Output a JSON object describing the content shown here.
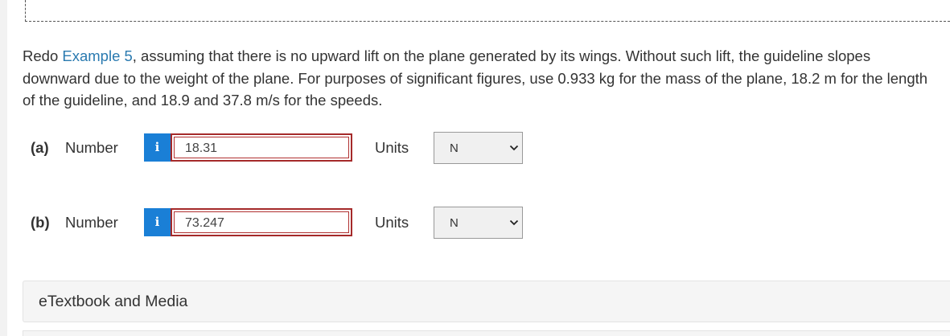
{
  "question": {
    "prefix": "Redo ",
    "link_text": "Example 5",
    "suffix": ", assuming that there is no upward lift on the plane generated by its wings. Without such lift, the guideline slopes downward due to the weight of the plane. For purposes of significant figures, use 0.933 kg for the mass of the plane, 18.2 m for the length of the guideline, and 18.9 and 37.8 m/s for the speeds."
  },
  "parts": [
    {
      "label": "(a)",
      "number_label": "Number",
      "info_icon": "i",
      "answer_value": "18.31",
      "units_label": "Units",
      "units_value": "N"
    },
    {
      "label": "(b)",
      "number_label": "Number",
      "info_icon": "i",
      "answer_value": "73.247",
      "units_label": "Units",
      "units_value": "N"
    }
  ],
  "etextbook": {
    "label": "eTextbook and Media"
  },
  "colors": {
    "link": "#2a7ab0",
    "info_button": "#1a7fd6",
    "answer_border_error": "#a52a2a"
  }
}
